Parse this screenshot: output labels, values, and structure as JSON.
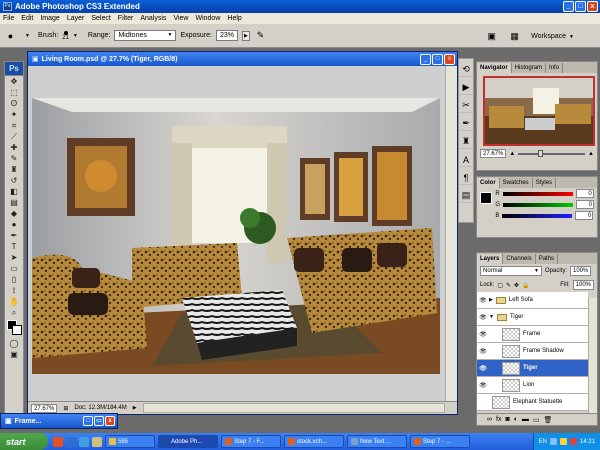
{
  "app": {
    "title": "Adobe Photoshop CS3 Extended",
    "window_controls": [
      "_",
      "□",
      "x"
    ]
  },
  "menu": [
    "File",
    "Edit",
    "Image",
    "Layer",
    "Select",
    "Filter",
    "Analysis",
    "View",
    "Window",
    "Help"
  ],
  "options_bar": {
    "brush_label": "Brush:",
    "brush_size": "21",
    "range_label": "Range:",
    "range_value": "Midtones",
    "exposure_label": "Exposure:",
    "exposure_value": "23%",
    "workspace_label": "Workspace"
  },
  "tools_panel": {
    "logo": "Ps"
  },
  "document": {
    "title": "Living Room.psd @ 27.7% (Tiger, RGB/8)",
    "zoom": "27.67%",
    "doc_size": "Doc: 12.3M/184.4M"
  },
  "navigator": {
    "tabs": [
      "Navigator",
      "Histogram",
      "Info"
    ],
    "active_tab": 0,
    "zoom": "27.67%"
  },
  "color_panel": {
    "tabs": [
      "Color",
      "Swatches",
      "Styles"
    ],
    "active_tab": 0,
    "channels": [
      {
        "label": "R",
        "value": "0",
        "color": "#e02020"
      },
      {
        "label": "G",
        "value": "0",
        "color": "#20a020"
      },
      {
        "label": "B",
        "value": "0",
        "color": "#2030d0"
      }
    ]
  },
  "layers_panel": {
    "tabs": [
      "Layers",
      "Channels",
      "Paths"
    ],
    "active_tab": 0,
    "blend_mode": "Normal",
    "opacity_label": "Opacity:",
    "opacity": "100%",
    "lock_label": "Lock:",
    "fill_label": "Fill:",
    "fill": "100%",
    "layers": [
      {
        "name": "Left Sofa",
        "type": "group",
        "indent": 0,
        "visible": true,
        "selected": false
      },
      {
        "name": "Tiger",
        "type": "group",
        "indent": 0,
        "visible": true,
        "selected": false
      },
      {
        "name": "Frame",
        "type": "layer",
        "indent": 1,
        "visible": true,
        "selected": false
      },
      {
        "name": "Frame Shadow",
        "type": "layer",
        "indent": 1,
        "visible": true,
        "selected": false
      },
      {
        "name": "Tiger",
        "type": "layer",
        "indent": 1,
        "visible": true,
        "selected": true
      },
      {
        "name": "Lion",
        "type": "layer",
        "indent": 1,
        "visible": true,
        "selected": false
      },
      {
        "name": "Elephant Statuette",
        "type": "layer",
        "indent": 0,
        "visible": false,
        "selected": false
      }
    ],
    "footer_icons": [
      "link-icon",
      "fx-icon",
      "mask-icon",
      "adjustment-icon",
      "folder-icon",
      "new-layer-icon",
      "trash-icon"
    ]
  },
  "minimized_window": {
    "title": "Frame..."
  },
  "taskbar": {
    "start": "start",
    "items": [
      {
        "label": "585",
        "color": "#e8c050",
        "active": false
      },
      {
        "label": "Adobe Ph...",
        "color": "#1a4fa0",
        "active": true
      },
      {
        "label": "Step 7 - F...",
        "color": "#e06020",
        "active": false
      },
      {
        "label": "stock.xch...",
        "color": "#e06020",
        "active": false
      },
      {
        "label": "New Text ...",
        "color": "#7da0d0",
        "active": false
      },
      {
        "label": "Step 7 - ...",
        "color": "#e06020",
        "active": false
      }
    ],
    "tray": {
      "lang": "EN",
      "time": "14:21"
    }
  }
}
